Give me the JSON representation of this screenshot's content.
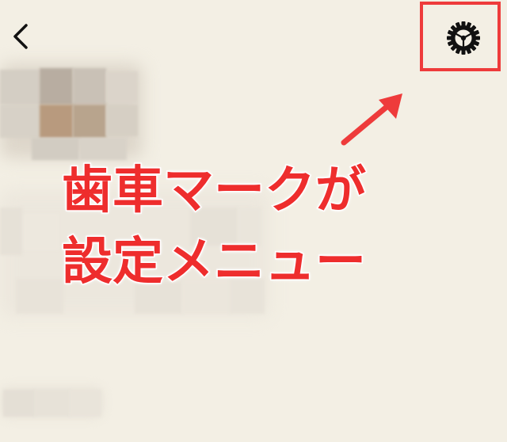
{
  "header": {
    "back_icon": "chevron-left-icon",
    "settings_icon": "gear-icon"
  },
  "annotation": {
    "line1": "歯車マークが",
    "line2": "設定メニュー",
    "color": "#ee2d2d",
    "highlight_color": "#ee3b3b"
  },
  "profile": {
    "obscured": true
  }
}
